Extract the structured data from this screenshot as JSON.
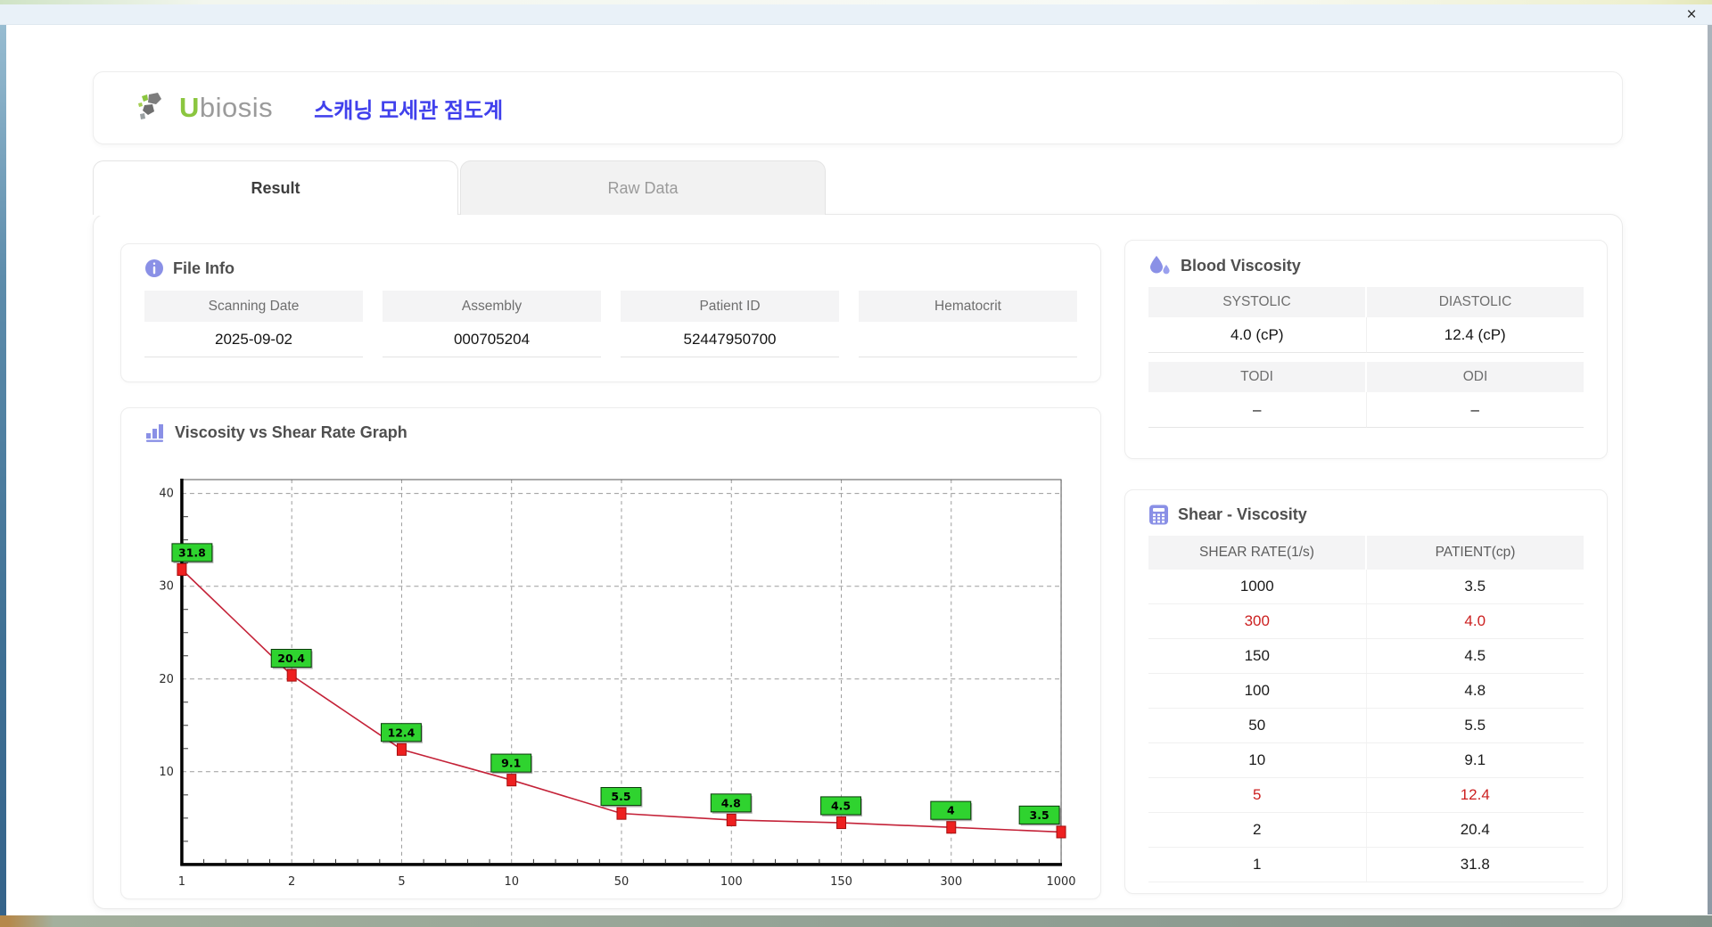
{
  "window": {
    "close_glyph": "×"
  },
  "header": {
    "brand_u": "U",
    "brand_rest": "biosis",
    "app_title": "스캐닝 모세관 점도계"
  },
  "tabs": {
    "result": "Result",
    "raw_data": "Raw Data"
  },
  "panels": {
    "file_info": {
      "title": "File Info",
      "fields": [
        {
          "label": "Scanning Date",
          "value": "2025-09-02"
        },
        {
          "label": "Assembly",
          "value": "000705204"
        },
        {
          "label": "Patient ID",
          "value": "52447950700"
        },
        {
          "label": "Hematocrit",
          "value": ""
        }
      ]
    },
    "blood_viscosity": {
      "title": "Blood Viscosity",
      "cells": [
        {
          "label": "SYSTOLIC",
          "value": "4.0 (cP)"
        },
        {
          "label": "DIASTOLIC",
          "value": "12.4 (cP)"
        },
        {
          "label": "TODI",
          "value": "–"
        },
        {
          "label": "ODI",
          "value": "–"
        }
      ]
    },
    "graph": {
      "title": "Viscosity vs Shear Rate Graph"
    },
    "shear_viscosity": {
      "title": "Shear - Viscosity",
      "columns": [
        "SHEAR RATE(1/s)",
        "PATIENT(cp)"
      ],
      "rows": [
        {
          "shear_rate": "1000",
          "patient": "3.5",
          "highlight": false
        },
        {
          "shear_rate": "300",
          "patient": "4.0",
          "highlight": true
        },
        {
          "shear_rate": "150",
          "patient": "4.5",
          "highlight": false
        },
        {
          "shear_rate": "100",
          "patient": "4.8",
          "highlight": false
        },
        {
          "shear_rate": "50",
          "patient": "5.5",
          "highlight": false
        },
        {
          "shear_rate": "10",
          "patient": "9.1",
          "highlight": false
        },
        {
          "shear_rate": "5",
          "patient": "12.4",
          "highlight": true
        },
        {
          "shear_rate": "2",
          "patient": "20.4",
          "highlight": false
        },
        {
          "shear_rate": "1",
          "patient": "31.8",
          "highlight": false
        }
      ]
    }
  },
  "chart_data": {
    "type": "line",
    "title": "Viscosity vs Shear Rate Graph",
    "x_scale": "categorical",
    "x": [
      1,
      2,
      5,
      10,
      50,
      100,
      150,
      300,
      1000
    ],
    "x_tick_labels": [
      "1",
      "2",
      "5",
      "10",
      "50",
      "100",
      "150",
      "300",
      "1000"
    ],
    "values": [
      31.8,
      20.4,
      12.4,
      9.1,
      5.5,
      4.8,
      4.5,
      4,
      3.5
    ],
    "point_labels": [
      "31.8",
      "20.4",
      "12.4",
      "9.1",
      "5.5",
      "4.8",
      "4.5",
      "4",
      "3.5"
    ],
    "y_ticks": [
      10,
      20,
      30,
      40
    ],
    "ylim": [
      0,
      41.5
    ],
    "grid": true,
    "legend": "none",
    "line_color": "#c42238",
    "marker_color": "#ee2020",
    "marker_edge": "#a50f0f",
    "label_bg": "#2fd32f",
    "label_edge": "#115511",
    "grid_color": "#9b9b9b",
    "axis_color": "#000000"
  }
}
